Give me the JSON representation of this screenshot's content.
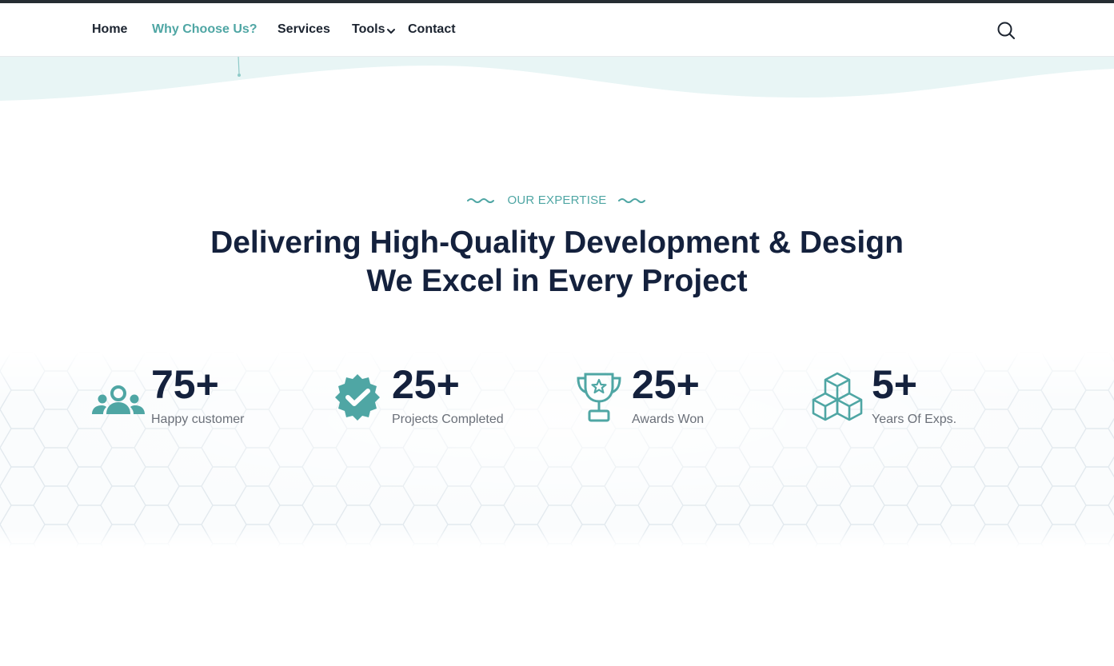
{
  "nav": {
    "items": [
      {
        "label": "Home",
        "active": false
      },
      {
        "label": "Why Choose Us?",
        "active": true
      },
      {
        "label": "Services",
        "active": false
      },
      {
        "label": "Tools",
        "active": false,
        "has_dropdown": true
      },
      {
        "label": "Contact",
        "active": false
      }
    ],
    "search_icon": "search-icon"
  },
  "section": {
    "eyebrow": "OUR EXPERTISE",
    "headline_line1": "Delivering High-Quality Development & Design",
    "headline_line2": "We Excel in Every Project"
  },
  "stats": [
    {
      "value": "75+",
      "label": "Happy customer",
      "icon": "users-group-icon"
    },
    {
      "value": "25+",
      "label": "Projects Completed",
      "icon": "verified-badge-icon"
    },
    {
      "value": "25+",
      "label": "Awards Won",
      "icon": "trophy-icon"
    },
    {
      "value": "5+",
      "label": "Years Of Exps.",
      "icon": "cubes-icon"
    }
  ],
  "colors": {
    "accent": "#4fa6a4",
    "heading": "#14213d",
    "muted": "#6b7079",
    "wave": "#e8f5f5",
    "top_strip": "#262d33"
  }
}
